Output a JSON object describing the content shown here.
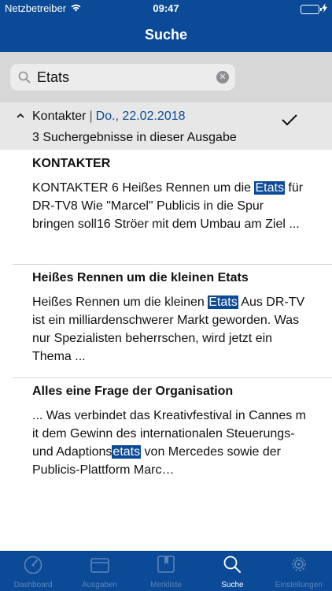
{
  "status_bar": {
    "carrier": "Netzbetreiber",
    "time": "09:47",
    "battery_level": 1.0
  },
  "nav": {
    "title": "Suche"
  },
  "search": {
    "query": "Etats"
  },
  "issue_header": {
    "name": "Kontakter",
    "separator": "|",
    "date": "Do., 22.02.2018",
    "result_count": "3 Suchergebnisse in dieser Ausgabe"
  },
  "results": [
    {
      "title": "KONTAKTER",
      "before": " KONTAKTER 6 Heißes Rennen um die ",
      "highlight": "Etats",
      "after": " für DR-TV8 Wie \"Marcel\" Publicis in die Spur bringen soll16 Ströer mit dem Umbau am Ziel ..."
    },
    {
      "title": "Heißes Rennen um die kleinen Etats",
      "before": " Heißes Rennen um die kleinen ",
      "highlight": "Etats",
      "after": " Aus DR-TV ist ein milliardenschwerer Markt geworden. Was nur Spezialisten beherrschen, wird jetzt ein Thema ..."
    },
    {
      "title": "Alles eine Frage der Organisation",
      "before": "... Was verbindet das Kreativfestival in Cannes m it dem Gewinn des internationalen Steuerungs- und Adaptions",
      "highlight": "etats",
      "after": " von Mercedes sowie der Publicis-Plattform Marc…"
    }
  ],
  "tabs": [
    {
      "label": "Dashboard",
      "icon": "speedometer-icon"
    },
    {
      "label": "Ausgaben",
      "icon": "newspaper-icon"
    },
    {
      "label": "Merkliste",
      "icon": "bookmark-icon"
    },
    {
      "label": "Suche",
      "icon": "search-icon"
    },
    {
      "label": "Einstellungen",
      "icon": "gear-icon"
    }
  ],
  "colors": {
    "brand": "#0b4a96",
    "tab_inactive": "#5d84b8",
    "highlight_bg": "#0b4a96"
  }
}
